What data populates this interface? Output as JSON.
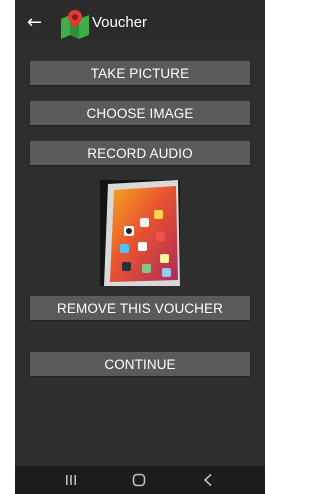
{
  "appbar": {
    "back_icon": "arrow-left-icon",
    "logo_icon": "map-pin-logo-icon",
    "title": "Voucher"
  },
  "actions": {
    "take_picture": "TAKE PICTURE",
    "choose_image": "CHOOSE IMAGE",
    "record_audio": "RECORD AUDIO",
    "remove_voucher": "REMOVE THIS VOUCHER",
    "continue": "CONTINUE"
  },
  "voucher": {
    "image_description_icon": "tablet-photo-thumbnail"
  },
  "navbar": {
    "recent_icon": "recent-apps-icon",
    "home_icon": "home-icon",
    "back_icon": "back-icon"
  },
  "colors": {
    "background": "#2e2e2e",
    "button": "#5a5a5a",
    "text": "#ffffff",
    "navbar": "#1c1c1c"
  }
}
